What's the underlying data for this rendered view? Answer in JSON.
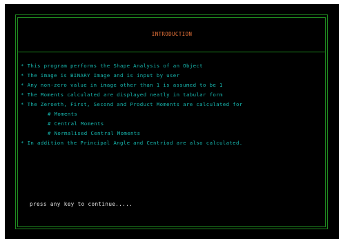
{
  "title": "INTRODUCTION",
  "bullets": [
    "* This program performs the Shape Analysis of an Object",
    "* The image is BINARY Image and is input by user",
    "* Any non-zero value in image other than 1 is assumed to be 1",
    "* The Moments calculated are displayed neatly in tabular form",
    "* The Zeroeth, First, Second and Product Moments are calculated for"
  ],
  "sub_items": [
    "# Moments",
    "# Central Moments",
    "# Normalised Central Moments"
  ],
  "final_bullet": "* In addition the Principal Angle and Centriod are also calculated.",
  "prompt": "press any key to continue.....",
  "colors": {
    "background": "#000000",
    "frame": "#1f8a1f",
    "title": "#e8733a",
    "body_text": "#17b8b0",
    "prompt_text": "#e6e6e6"
  }
}
